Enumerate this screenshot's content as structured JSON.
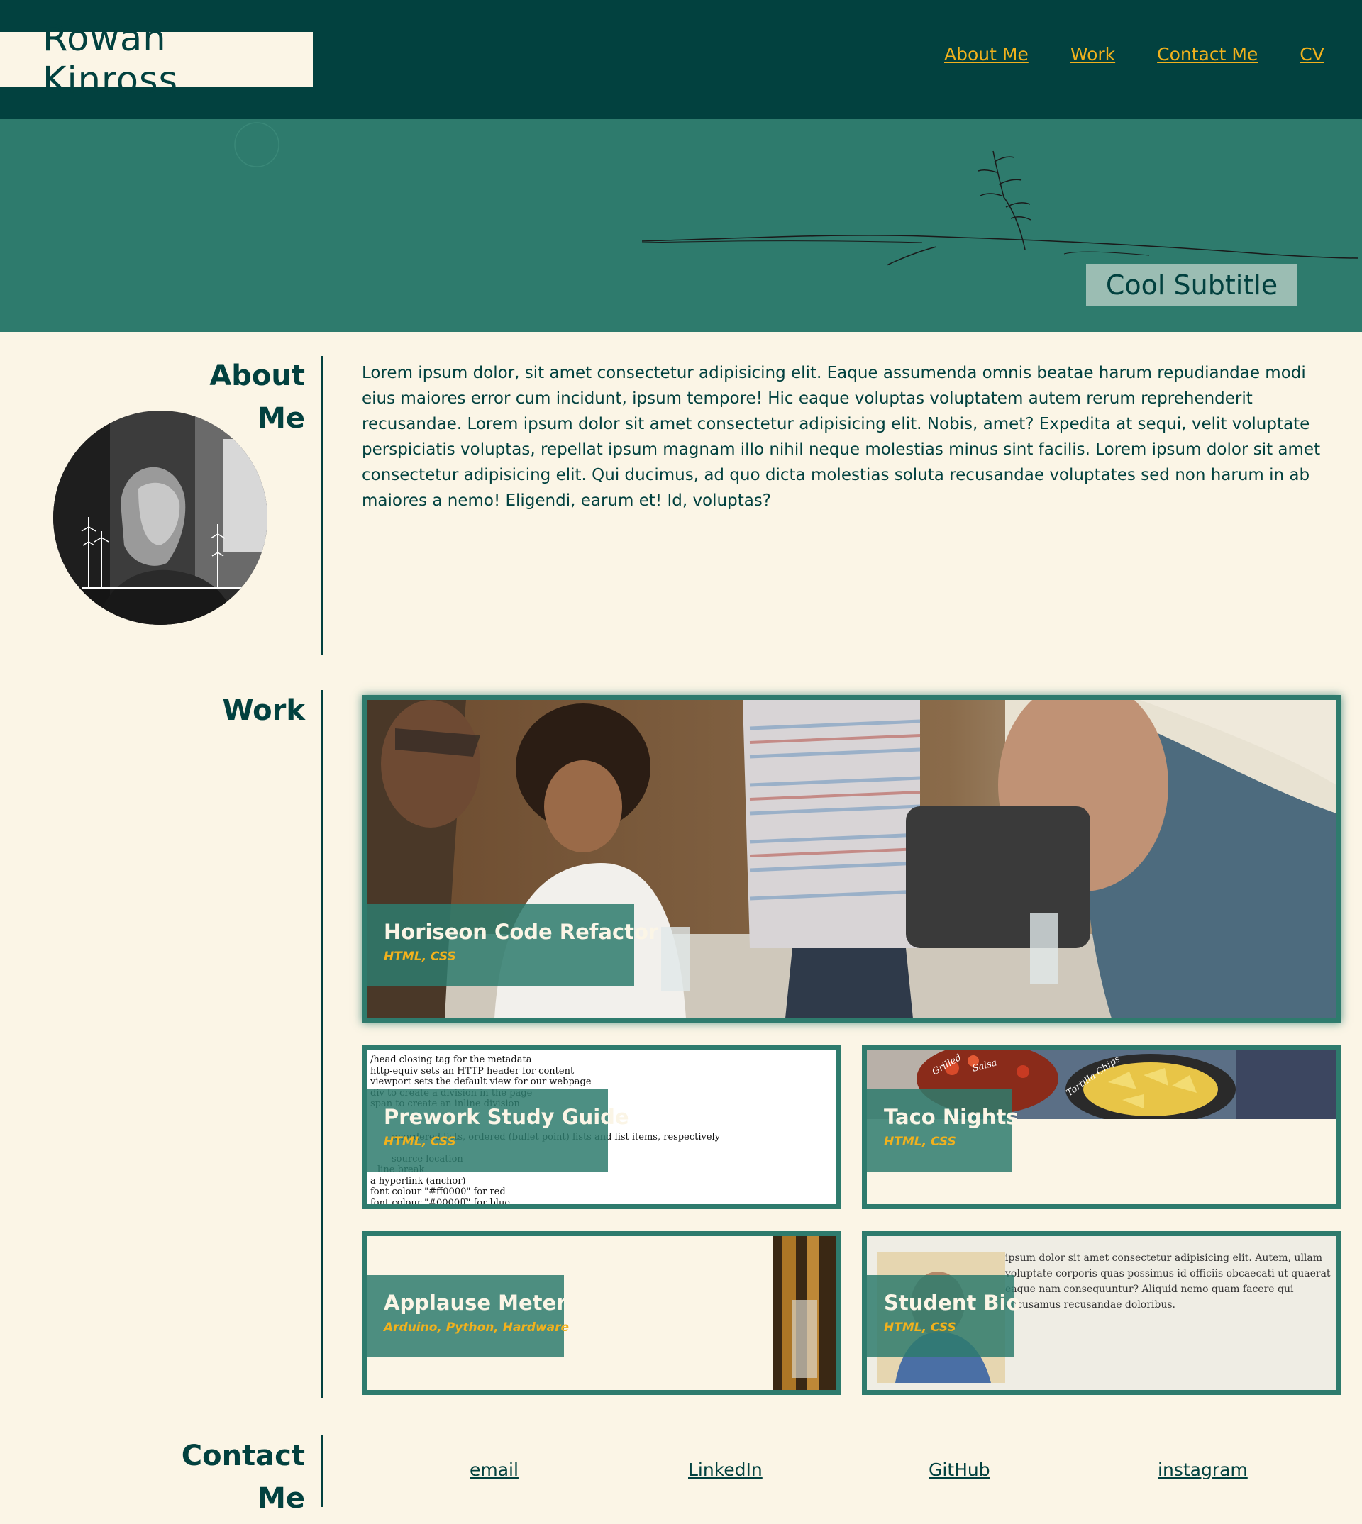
{
  "header": {
    "brand": "Rowan Kinross",
    "nav": [
      "About Me",
      "Work",
      "Contact Me",
      "CV"
    ]
  },
  "hero": {
    "subtitle": "Cool Subtitle"
  },
  "about": {
    "title_line1": "About",
    "title_line2": "Me",
    "text": "Lorem ipsum dolor, sit amet consectetur adipisicing elit. Eaque assumenda omnis beatae harum repudiandae modi eius maiores error cum incidunt, ipsum tempore! Hic eaque voluptas voluptatem autem rerum reprehenderit recusandae. Lorem ipsum dolor sit amet consectetur adipisicing elit. Nobis, amet? Expedita at sequi, velit voluptate perspiciatis voluptas, repellat ipsum magnam illo nihil neque molestias minus sint facilis. Lorem ipsum dolor sit amet consectetur adipisicing elit. Qui ducimus, ad quo dicta molestias soluta recusandae voluptates sed non harum in ab maiores a nemo! Eligendi, earum et! Id, voluptas?"
  },
  "work": {
    "title": "Work",
    "projects": [
      {
        "title": "Horiseon Code Refactor",
        "tags": "HTML, CSS"
      },
      {
        "title": "Prework Study Guide",
        "tags": "HTML, CSS"
      },
      {
        "title": "Taco Nights",
        "tags": "HTML, CSS"
      },
      {
        "title": "Applause Meter",
        "tags": "Arduino, Python, Hardware"
      },
      {
        "title": "Student Bio",
        "tags": "HTML, CSS"
      }
    ],
    "guide_lines": [
      "/head closing tag for the metadata",
      "http-equiv sets an HTTP header for content",
      "viewport sets the default view for our webpage",
      "div to create a division in the page",
      "span to create an inline division",
      "unordered lists, ordered (bullet point) lists and list items, respectively",
      "source location",
      "line break",
      "a hyperlink (anchor)",
      "font colour \"#ff0000\" for red",
      "font colour \"#0000ff\" for blue"
    ],
    "bio_text": "ipsum dolor sit amet consectetur adipisicing elit. Autem, ullam voluptate corporis quas possimus id officiis obcaecati ut quaerat eaque nam consequuntur? Aliquid nemo quam facere qui accusamus recusandae doloribus.",
    "taco_labels": [
      "Grilled",
      "Salsa",
      "Tortilla Chips"
    ]
  },
  "contact": {
    "title_line1": "Contact",
    "title_line2": "Me",
    "links": [
      "email",
      "LinkedIn",
      "GitHub",
      "instagram"
    ]
  },
  "colors": {
    "dark_teal": "#02413f",
    "teal": "#2e7b6d",
    "cream": "#fbf5e6",
    "gold": "#f1b11d"
  }
}
